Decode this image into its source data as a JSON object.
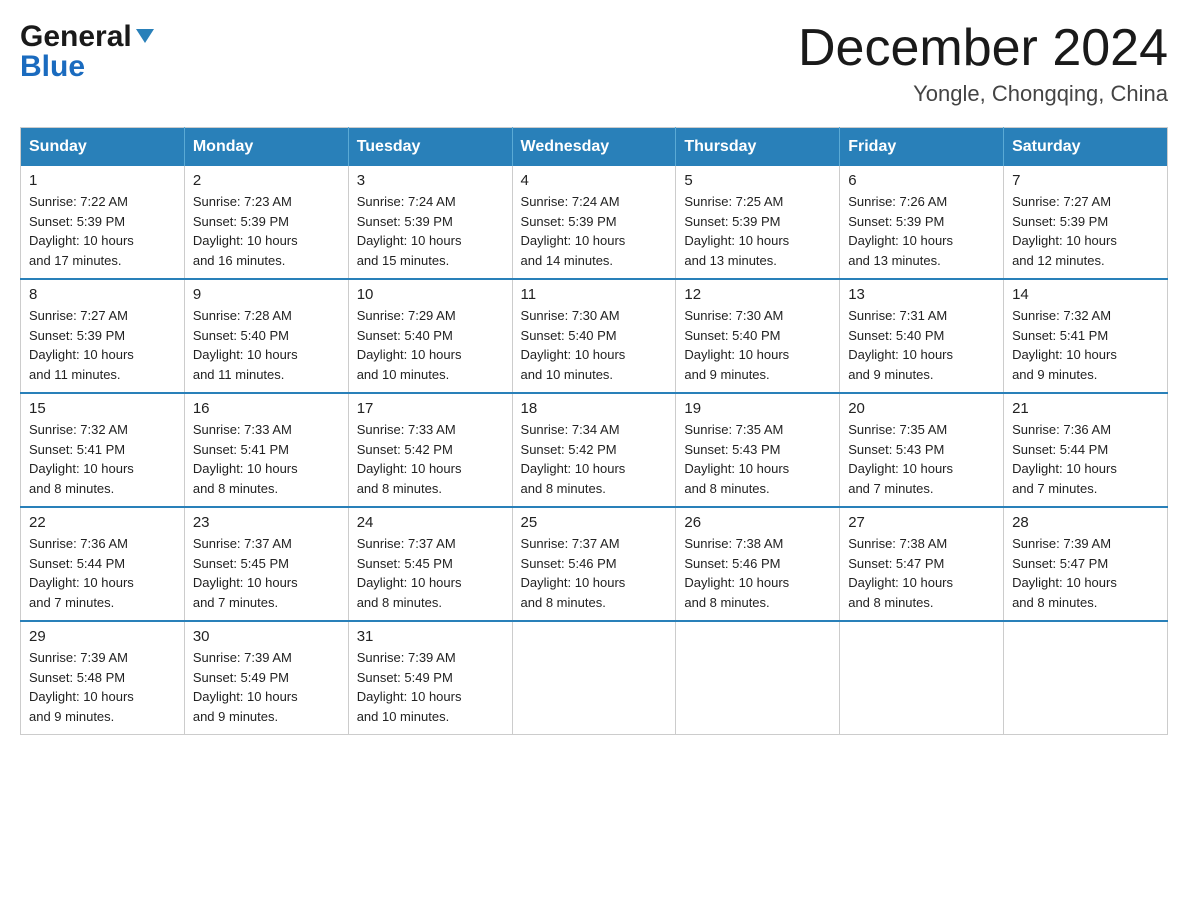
{
  "header": {
    "logo_general": "General",
    "logo_blue": "Blue",
    "month_year": "December 2024",
    "location": "Yongle, Chongqing, China"
  },
  "days_of_week": [
    "Sunday",
    "Monday",
    "Tuesday",
    "Wednesday",
    "Thursday",
    "Friday",
    "Saturday"
  ],
  "weeks": [
    [
      {
        "day": "1",
        "sunrise": "7:22 AM",
        "sunset": "5:39 PM",
        "daylight": "10 hours and 17 minutes."
      },
      {
        "day": "2",
        "sunrise": "7:23 AM",
        "sunset": "5:39 PM",
        "daylight": "10 hours and 16 minutes."
      },
      {
        "day": "3",
        "sunrise": "7:24 AM",
        "sunset": "5:39 PM",
        "daylight": "10 hours and 15 minutes."
      },
      {
        "day": "4",
        "sunrise": "7:24 AM",
        "sunset": "5:39 PM",
        "daylight": "10 hours and 14 minutes."
      },
      {
        "day": "5",
        "sunrise": "7:25 AM",
        "sunset": "5:39 PM",
        "daylight": "10 hours and 13 minutes."
      },
      {
        "day": "6",
        "sunrise": "7:26 AM",
        "sunset": "5:39 PM",
        "daylight": "10 hours and 13 minutes."
      },
      {
        "day": "7",
        "sunrise": "7:27 AM",
        "sunset": "5:39 PM",
        "daylight": "10 hours and 12 minutes."
      }
    ],
    [
      {
        "day": "8",
        "sunrise": "7:27 AM",
        "sunset": "5:39 PM",
        "daylight": "10 hours and 11 minutes."
      },
      {
        "day": "9",
        "sunrise": "7:28 AM",
        "sunset": "5:40 PM",
        "daylight": "10 hours and 11 minutes."
      },
      {
        "day": "10",
        "sunrise": "7:29 AM",
        "sunset": "5:40 PM",
        "daylight": "10 hours and 10 minutes."
      },
      {
        "day": "11",
        "sunrise": "7:30 AM",
        "sunset": "5:40 PM",
        "daylight": "10 hours and 10 minutes."
      },
      {
        "day": "12",
        "sunrise": "7:30 AM",
        "sunset": "5:40 PM",
        "daylight": "10 hours and 9 minutes."
      },
      {
        "day": "13",
        "sunrise": "7:31 AM",
        "sunset": "5:40 PM",
        "daylight": "10 hours and 9 minutes."
      },
      {
        "day": "14",
        "sunrise": "7:32 AM",
        "sunset": "5:41 PM",
        "daylight": "10 hours and 9 minutes."
      }
    ],
    [
      {
        "day": "15",
        "sunrise": "7:32 AM",
        "sunset": "5:41 PM",
        "daylight": "10 hours and 8 minutes."
      },
      {
        "day": "16",
        "sunrise": "7:33 AM",
        "sunset": "5:41 PM",
        "daylight": "10 hours and 8 minutes."
      },
      {
        "day": "17",
        "sunrise": "7:33 AM",
        "sunset": "5:42 PM",
        "daylight": "10 hours and 8 minutes."
      },
      {
        "day": "18",
        "sunrise": "7:34 AM",
        "sunset": "5:42 PM",
        "daylight": "10 hours and 8 minutes."
      },
      {
        "day": "19",
        "sunrise": "7:35 AM",
        "sunset": "5:43 PM",
        "daylight": "10 hours and 8 minutes."
      },
      {
        "day": "20",
        "sunrise": "7:35 AM",
        "sunset": "5:43 PM",
        "daylight": "10 hours and 7 minutes."
      },
      {
        "day": "21",
        "sunrise": "7:36 AM",
        "sunset": "5:44 PM",
        "daylight": "10 hours and 7 minutes."
      }
    ],
    [
      {
        "day": "22",
        "sunrise": "7:36 AM",
        "sunset": "5:44 PM",
        "daylight": "10 hours and 7 minutes."
      },
      {
        "day": "23",
        "sunrise": "7:37 AM",
        "sunset": "5:45 PM",
        "daylight": "10 hours and 7 minutes."
      },
      {
        "day": "24",
        "sunrise": "7:37 AM",
        "sunset": "5:45 PM",
        "daylight": "10 hours and 8 minutes."
      },
      {
        "day": "25",
        "sunrise": "7:37 AM",
        "sunset": "5:46 PM",
        "daylight": "10 hours and 8 minutes."
      },
      {
        "day": "26",
        "sunrise": "7:38 AM",
        "sunset": "5:46 PM",
        "daylight": "10 hours and 8 minutes."
      },
      {
        "day": "27",
        "sunrise": "7:38 AM",
        "sunset": "5:47 PM",
        "daylight": "10 hours and 8 minutes."
      },
      {
        "day": "28",
        "sunrise": "7:39 AM",
        "sunset": "5:47 PM",
        "daylight": "10 hours and 8 minutes."
      }
    ],
    [
      {
        "day": "29",
        "sunrise": "7:39 AM",
        "sunset": "5:48 PM",
        "daylight": "10 hours and 9 minutes."
      },
      {
        "day": "30",
        "sunrise": "7:39 AM",
        "sunset": "5:49 PM",
        "daylight": "10 hours and 9 minutes."
      },
      {
        "day": "31",
        "sunrise": "7:39 AM",
        "sunset": "5:49 PM",
        "daylight": "10 hours and 10 minutes."
      },
      null,
      null,
      null,
      null
    ]
  ],
  "labels": {
    "sunrise": "Sunrise:",
    "sunset": "Sunset:",
    "daylight": "Daylight:"
  }
}
